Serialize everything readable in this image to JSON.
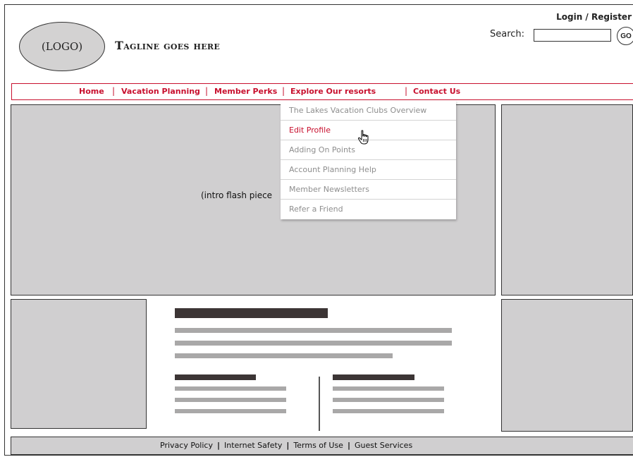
{
  "header": {
    "logo_text": "(LOGO)",
    "tagline": "Tagline goes here",
    "login_register": "Login / Register",
    "search_label": "Search:",
    "search_value": "",
    "go_label": "GO"
  },
  "nav": {
    "items": [
      {
        "label": "Home"
      },
      {
        "label": "Vacation Planning"
      },
      {
        "label": "Member Perks"
      },
      {
        "label": "Explore Our resorts"
      },
      {
        "label": "Contact Us"
      }
    ],
    "separator": "|"
  },
  "dropdown": {
    "items": [
      {
        "label": "The Lakes Vacation Clubs Overview"
      },
      {
        "label": "Edit Profile"
      },
      {
        "label": "Adding On Points"
      },
      {
        "label": "Account Planning Help"
      },
      {
        "label": "Member Newsletters"
      },
      {
        "label": "Refer a Friend"
      }
    ],
    "highlighted_index": 1
  },
  "main": {
    "flash_label": "(intro flash piece"
  },
  "footer": {
    "links": [
      {
        "label": "Privacy Policy"
      },
      {
        "label": "Internet Safety"
      },
      {
        "label": "Terms of Use"
      },
      {
        "label": "Guest Services"
      }
    ],
    "separator": "|"
  },
  "colors": {
    "accent": "#c8102e",
    "placeholder_gray": "#d0cfd0",
    "text_line_gray": "#a9a8a8",
    "heading_bar_dark": "#3c3535",
    "menu_text_gray": "#8e8e8e"
  },
  "icons": {
    "cursor": "hand-pointer-icon"
  }
}
